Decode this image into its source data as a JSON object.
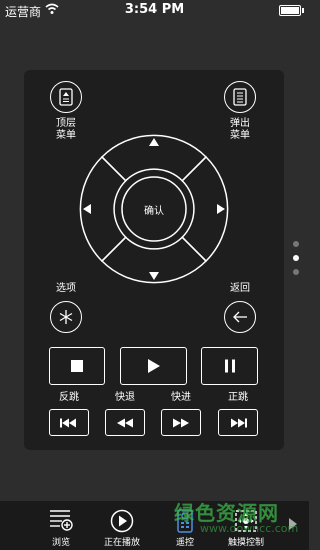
{
  "status": {
    "carrier": "运营商",
    "time": "3:54 PM"
  },
  "remote": {
    "top_menu_label": "顶层\n菜单",
    "popup_menu_label": "弹出\n菜单",
    "ok_label": "确认",
    "options_label": "选项",
    "back_label": "返回",
    "skip_back_label": "反跳",
    "rewind_label": "快退",
    "forward_label": "快进",
    "skip_forward_label": "正跳"
  },
  "page_indicator": {
    "count": 3,
    "current": 2
  },
  "tabbar": {
    "tabs": [
      {
        "label": "浏览",
        "icon": "browse-list-icon"
      },
      {
        "label": "正在播放",
        "icon": "play-circle-icon"
      },
      {
        "label": "遥控",
        "icon": "remote-control-icon"
      },
      {
        "label": "触摸控制",
        "icon": "touch-control-icon"
      }
    ]
  },
  "watermark": {
    "text": "绿色资源网",
    "url": "www.downcc.com"
  },
  "colors": {
    "background": "#2d2d2d",
    "panel": "#1e1e1e",
    "tabbar": "#1a1a1a",
    "foreground": "#ffffff",
    "watermark": "#3db34a"
  }
}
